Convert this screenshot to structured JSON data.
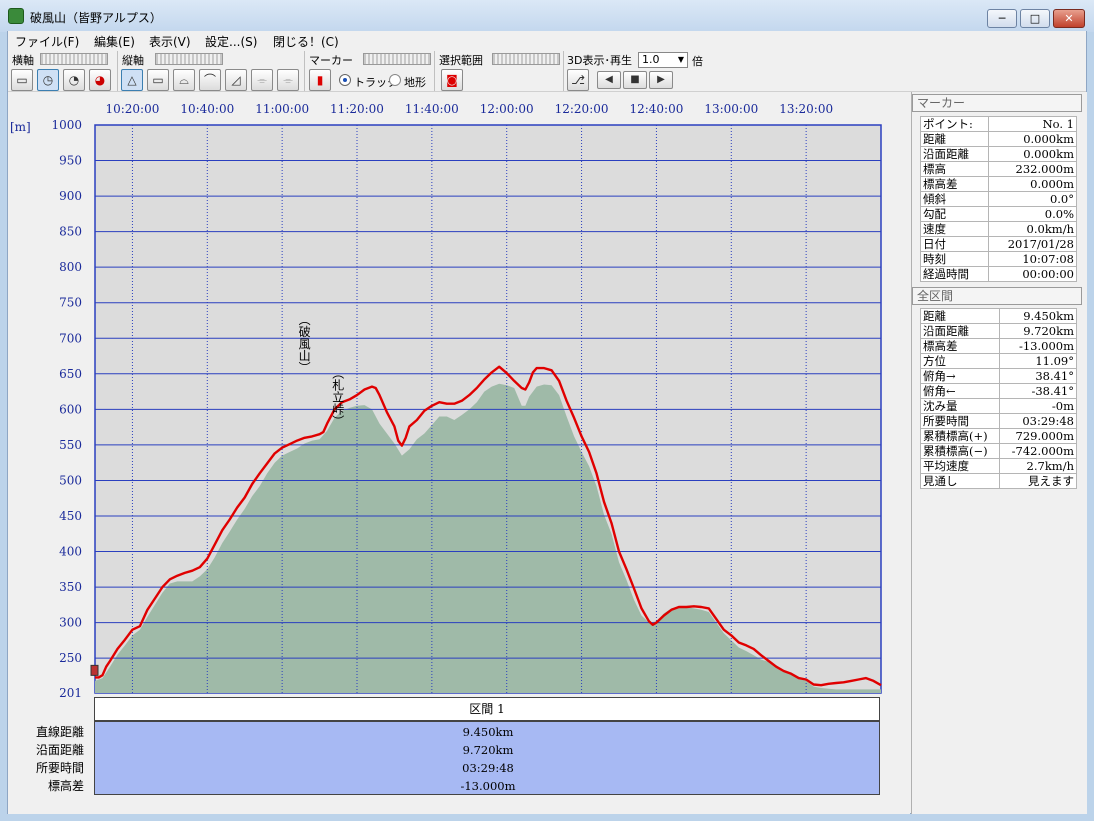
{
  "window": {
    "title": "破風山（皆野アルプス）",
    "minimize": "─",
    "maximize": "□",
    "close": "✕"
  },
  "menu": [
    "ファイル(F)",
    "編集(E)",
    "表示(V)",
    "設定...(S)",
    "閉じる！(C)"
  ],
  "toolbar": {
    "horizontal_axis": "横軸",
    "vertical_axis": "縦軸",
    "marker": "マーカー",
    "track": "トラック",
    "terrain": "地形",
    "selection_range": "選択範囲",
    "play3d": "3D表示･再生",
    "speed_value": "1.0",
    "speed_unit": "倍"
  },
  "chart_data": {
    "type": "area",
    "ylabel": "[m]",
    "ylim": [
      201,
      1000
    ],
    "y_ticks": [
      "1000",
      "950",
      "900",
      "850",
      "800",
      "750",
      "700",
      "650",
      "600",
      "550",
      "500",
      "450",
      "400",
      "350",
      "300",
      "250",
      "201"
    ],
    "x_ticks": [
      "10:20:00",
      "10:40:00",
      "11:00:00",
      "11:20:00",
      "11:40:00",
      "12:00:00",
      "12:20:00",
      "12:40:00",
      "13:00:00",
      "13:20:00"
    ],
    "x_range_minutes": [
      10.0,
      220.0
    ],
    "annotations": [
      {
        "text": "(破風山)",
        "x_min": 66,
        "y": 630
      },
      {
        "text": "(札立峠)",
        "x_min": 75,
        "y": 555
      }
    ],
    "series": [
      {
        "type": "line",
        "color": "#e00000",
        "points": [
          [
            10,
            223
          ],
          [
            11,
            223
          ],
          [
            12,
            226
          ],
          [
            13,
            238
          ],
          [
            14,
            246
          ],
          [
            16,
            263
          ],
          [
            18,
            276
          ],
          [
            20,
            290
          ],
          [
            22,
            295
          ],
          [
            24,
            318
          ],
          [
            26,
            334
          ],
          [
            28,
            350
          ],
          [
            30,
            361
          ],
          [
            32,
            366
          ],
          [
            34,
            370
          ],
          [
            36,
            373
          ],
          [
            38,
            378
          ],
          [
            40,
            390
          ],
          [
            42,
            410
          ],
          [
            44,
            430
          ],
          [
            46,
            445
          ],
          [
            48,
            462
          ],
          [
            50,
            476
          ],
          [
            52,
            495
          ],
          [
            54,
            510
          ],
          [
            56,
            524
          ],
          [
            58,
            538
          ],
          [
            60,
            546
          ],
          [
            62,
            551
          ],
          [
            64,
            556
          ],
          [
            66,
            560
          ],
          [
            68,
            562
          ],
          [
            70,
            565
          ],
          [
            71,
            568
          ],
          [
            72,
            580
          ],
          [
            74,
            600
          ],
          [
            76,
            610
          ],
          [
            78,
            614
          ],
          [
            80,
            620
          ],
          [
            82,
            628
          ],
          [
            84,
            632
          ],
          [
            85,
            630
          ],
          [
            86,
            620
          ],
          [
            88,
            596
          ],
          [
            90,
            576
          ],
          [
            91,
            556
          ],
          [
            92,
            549
          ],
          [
            93,
            560
          ],
          [
            94,
            576
          ],
          [
            96,
            585
          ],
          [
            98,
            598
          ],
          [
            100,
            605
          ],
          [
            102,
            610
          ],
          [
            104,
            608
          ],
          [
            106,
            608
          ],
          [
            108,
            612
          ],
          [
            110,
            620
          ],
          [
            112,
            630
          ],
          [
            114,
            642
          ],
          [
            116,
            652
          ],
          [
            118,
            660
          ],
          [
            120,
            651
          ],
          [
            122,
            640
          ],
          [
            124,
            630
          ],
          [
            125,
            628
          ],
          [
            126,
            638
          ],
          [
            127,
            652
          ],
          [
            128,
            658
          ],
          [
            130,
            658
          ],
          [
            132,
            655
          ],
          [
            134,
            640
          ],
          [
            136,
            612
          ],
          [
            138,
            588
          ],
          [
            140,
            562
          ],
          [
            142,
            540
          ],
          [
            144,
            510
          ],
          [
            146,
            470
          ],
          [
            148,
            440
          ],
          [
            150,
            400
          ],
          [
            152,
            375
          ],
          [
            154,
            348
          ],
          [
            156,
            320
          ],
          [
            158,
            302
          ],
          [
            159,
            297
          ],
          [
            160,
            300
          ],
          [
            162,
            310
          ],
          [
            164,
            318
          ],
          [
            166,
            322
          ],
          [
            168,
            322
          ],
          [
            170,
            323
          ],
          [
            172,
            322
          ],
          [
            174,
            320
          ],
          [
            176,
            305
          ],
          [
            178,
            290
          ],
          [
            180,
            282
          ],
          [
            182,
            272
          ],
          [
            184,
            268
          ],
          [
            186,
            263
          ],
          [
            188,
            254
          ],
          [
            190,
            246
          ],
          [
            192,
            238
          ],
          [
            194,
            232
          ],
          [
            196,
            228
          ],
          [
            198,
            222
          ],
          [
            200,
            220
          ],
          [
            202,
            213
          ],
          [
            204,
            212
          ],
          [
            206,
            214
          ],
          [
            208,
            215
          ],
          [
            210,
            216
          ],
          [
            212,
            218
          ],
          [
            214,
            220
          ],
          [
            216,
            222
          ],
          [
            218,
            218
          ],
          [
            220,
            212
          ]
        ]
      },
      {
        "type": "area",
        "color": "#9fbaa8",
        "points": [
          [
            10,
            218
          ],
          [
            12,
            222
          ],
          [
            14,
            238
          ],
          [
            16,
            255
          ],
          [
            18,
            268
          ],
          [
            20,
            282
          ],
          [
            22,
            290
          ],
          [
            24,
            308
          ],
          [
            26,
            325
          ],
          [
            28,
            342
          ],
          [
            30,
            355
          ],
          [
            32,
            358
          ],
          [
            34,
            358
          ],
          [
            36,
            358
          ],
          [
            38,
            365
          ],
          [
            40,
            375
          ],
          [
            42,
            392
          ],
          [
            44,
            412
          ],
          [
            46,
            428
          ],
          [
            48,
            445
          ],
          [
            50,
            460
          ],
          [
            52,
            478
          ],
          [
            54,
            492
          ],
          [
            56,
            510
          ],
          [
            58,
            525
          ],
          [
            60,
            535
          ],
          [
            62,
            540
          ],
          [
            64,
            545
          ],
          [
            66,
            552
          ],
          [
            68,
            556
          ],
          [
            70,
            558
          ],
          [
            72,
            570
          ],
          [
            74,
            588
          ],
          [
            76,
            598
          ],
          [
            78,
            602
          ],
          [
            80,
            605
          ],
          [
            82,
            606
          ],
          [
            84,
            600
          ],
          [
            86,
            580
          ],
          [
            88,
            566
          ],
          [
            90,
            552
          ],
          [
            92,
            535
          ],
          [
            94,
            544
          ],
          [
            96,
            558
          ],
          [
            98,
            566
          ],
          [
            100,
            578
          ],
          [
            102,
            590
          ],
          [
            104,
            590
          ],
          [
            106,
            585
          ],
          [
            108,
            592
          ],
          [
            110,
            600
          ],
          [
            112,
            610
          ],
          [
            114,
            625
          ],
          [
            116,
            632
          ],
          [
            118,
            636
          ],
          [
            120,
            634
          ],
          [
            122,
            630
          ],
          [
            124,
            605
          ],
          [
            125,
            605
          ],
          [
            126,
            618
          ],
          [
            128,
            632
          ],
          [
            130,
            635
          ],
          [
            132,
            634
          ],
          [
            134,
            620
          ],
          [
            136,
            590
          ],
          [
            138,
            562
          ],
          [
            140,
            540
          ],
          [
            142,
            520
          ],
          [
            144,
            492
          ],
          [
            146,
            452
          ],
          [
            148,
            425
          ],
          [
            150,
            385
          ],
          [
            152,
            360
          ],
          [
            154,
            332
          ],
          [
            156,
            310
          ],
          [
            158,
            300
          ],
          [
            160,
            302
          ],
          [
            162,
            313
          ],
          [
            164,
            320
          ],
          [
            166,
            322
          ],
          [
            168,
            322
          ],
          [
            170,
            320
          ],
          [
            172,
            318
          ],
          [
            174,
            315
          ],
          [
            176,
            300
          ],
          [
            178,
            285
          ],
          [
            180,
            275
          ],
          [
            182,
            265
          ],
          [
            184,
            260
          ],
          [
            186,
            254
          ],
          [
            188,
            248
          ],
          [
            190,
            245
          ],
          [
            192,
            240
          ],
          [
            194,
            233
          ],
          [
            196,
            228
          ],
          [
            198,
            222
          ],
          [
            200,
            218
          ],
          [
            202,
            210
          ],
          [
            204,
            208
          ],
          [
            206,
            207
          ],
          [
            208,
            206
          ],
          [
            210,
            206
          ],
          [
            212,
            206
          ],
          [
            214,
            206
          ],
          [
            216,
            206
          ],
          [
            218,
            206
          ],
          [
            220,
            206
          ]
        ]
      }
    ]
  },
  "summary": {
    "header": "区間 1",
    "labels": [
      "直線距離",
      "沿面距離",
      "所要時間",
      "標高差"
    ],
    "values": [
      "9.450km",
      "9.720km",
      "03:29:48",
      "-13.000m"
    ]
  },
  "marker_panel": {
    "title": "マーカー",
    "rows": [
      [
        "ポイント:",
        "No. 1"
      ],
      [
        "距離",
        "0.000km"
      ],
      [
        "沿面距離",
        "0.000km"
      ],
      [
        "標高",
        "232.000m"
      ],
      [
        "標高差",
        "0.000m"
      ],
      [
        "傾斜",
        "0.0°"
      ],
      [
        "勾配",
        "0.0%"
      ],
      [
        "速度",
        "0.0km/h"
      ],
      [
        "日付",
        "2017/01/28"
      ],
      [
        "時刻",
        "10:07:08"
      ],
      [
        "経過時間",
        "00:00:00"
      ]
    ]
  },
  "overall_panel": {
    "title": "全区間",
    "rows": [
      [
        "距離",
        "9.450km"
      ],
      [
        "沿面距離",
        "9.720km"
      ],
      [
        "標高差",
        "-13.000m"
      ],
      [
        "方位",
        "11.09°"
      ],
      [
        "俯角→",
        "38.41°"
      ],
      [
        "俯角←",
        "-38.41°"
      ],
      [
        "沈み量",
        "-0m"
      ],
      [
        "所要時間",
        "03:29:48"
      ],
      [
        "累積標高(+)",
        "729.000m"
      ],
      [
        "累積標高(−)",
        "-742.000m"
      ],
      [
        "平均速度",
        "2.7km/h"
      ],
      [
        "見通し",
        "見えます"
      ]
    ]
  }
}
